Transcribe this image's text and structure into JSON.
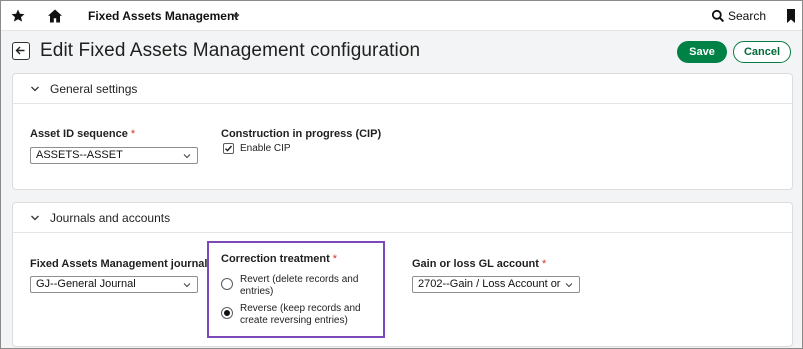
{
  "topbar": {
    "app_title": "Fixed Assets Management",
    "search_label": "Search",
    "icons": [
      "star-icon",
      "home-icon",
      "chevron-down-icon",
      "search-icon",
      "bookmark-icon"
    ]
  },
  "header": {
    "title": "Edit Fixed Assets Management configuration",
    "save_label": "Save",
    "cancel_label": "Cancel"
  },
  "general_settings": {
    "section_title": "General settings",
    "asset_id_sequence": {
      "label": "Asset ID sequence",
      "required_mark": "*",
      "value": "ASSETS--ASSET"
    },
    "cip": {
      "label": "Construction in progress (CIP)",
      "checkbox_label": "Enable CIP",
      "checked": true
    }
  },
  "journals": {
    "section_title": "Journals and accounts",
    "fam_journal": {
      "label": "Fixed Assets Management journal",
      "value": "GJ--General Journal"
    },
    "correction_treatment": {
      "label": "Correction treatment",
      "required_mark": "*",
      "options": [
        {
          "line1": "Revert (delete records and",
          "line2": "entries)",
          "selected": false
        },
        {
          "line1": "Reverse (keep records and",
          "line2": "create reversing entries)",
          "selected": true
        }
      ]
    },
    "gain_loss_gl": {
      "label": "Gain or loss GL account",
      "required_mark": "*",
      "value": "2702--Gain / Loss Account or"
    }
  },
  "colors": {
    "primary_green": "#008146",
    "highlight_purple": "#7a4ab8",
    "required_red": "#d4351c"
  }
}
